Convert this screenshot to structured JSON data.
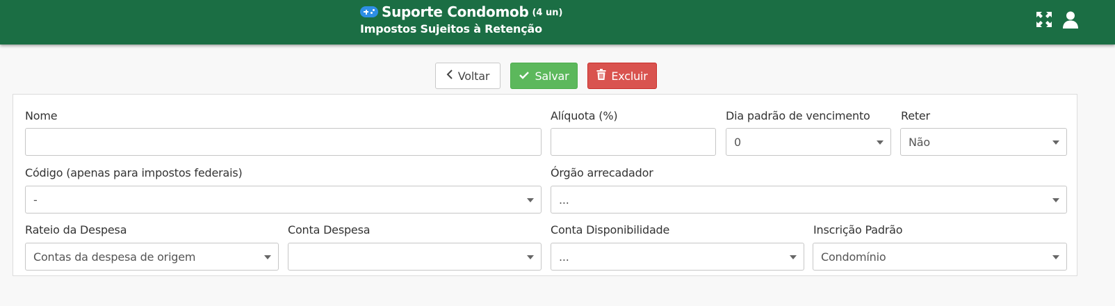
{
  "header": {
    "app_name": "Suporte Condomob",
    "app_count": "(4 un)",
    "page_title": "Impostos Sujeitos à Retenção",
    "icons": {
      "app": "gamepad-icon",
      "expand": "expand-icon",
      "user": "user-icon"
    },
    "background_color": "#1b6e44"
  },
  "toolbar": {
    "back_label": "Voltar",
    "save_label": "Salvar",
    "delete_label": "Excluir"
  },
  "form": {
    "nome": {
      "label": "Nome",
      "value": ""
    },
    "aliquota": {
      "label": "Alíquota (%)",
      "value": ""
    },
    "dia_vencimento": {
      "label": "Dia padrão de vencimento",
      "value": "0"
    },
    "reter": {
      "label": "Reter",
      "value": "Não"
    },
    "codigo": {
      "label": "Código (apenas para impostos federais)",
      "value": "-"
    },
    "orgao": {
      "label": "Órgão arrecadador",
      "value": "..."
    },
    "rateio": {
      "label": "Rateio da Despesa",
      "value": "Contas da despesa de origem"
    },
    "conta_despesa": {
      "label": "Conta Despesa",
      "value": ""
    },
    "conta_disponibilidade": {
      "label": "Conta Disponibilidade",
      "value": "..."
    },
    "inscricao": {
      "label": "Inscrição Padrão",
      "value": "Condomínio"
    }
  },
  "colors": {
    "save": "#5cb85c",
    "delete": "#d9534f",
    "accent": "#2e8fe6"
  }
}
